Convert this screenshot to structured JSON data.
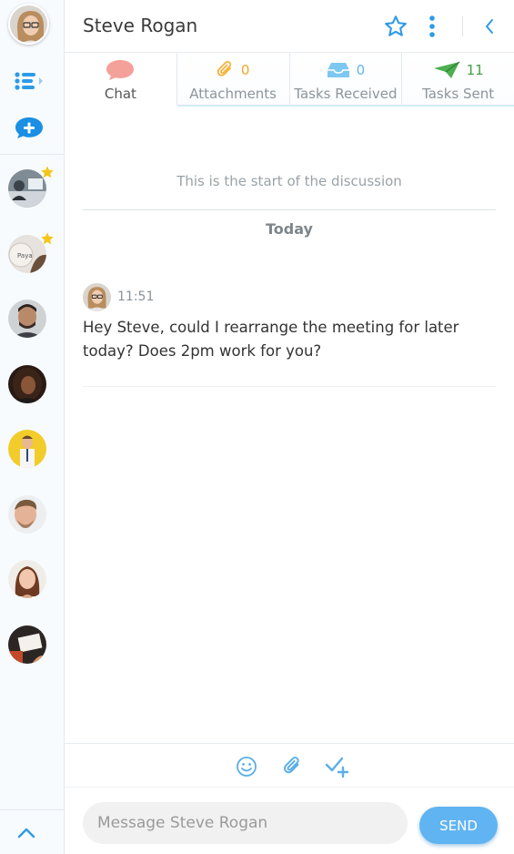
{
  "header": {
    "contact_name": "Steve Rogan"
  },
  "tabs": [
    {
      "label": "Chat",
      "icon": "speech-bubble-icon",
      "color": "#f4a19a"
    },
    {
      "label": "Attachments",
      "icon": "paperclip-icon",
      "count": "0",
      "color": "#f5b23a"
    },
    {
      "label": "Tasks Received",
      "icon": "inbox-tray-icon",
      "count": "0",
      "color": "#7cc8f2"
    },
    {
      "label": "Tasks Sent",
      "icon": "paper-plane-icon",
      "count": "11",
      "color": "#4caf50"
    }
  ],
  "chat": {
    "start_note": "This is the start of the discussion",
    "date_divider": "Today",
    "messages": [
      {
        "time": "11:51",
        "text": "Hey Steve, could I rearrange the meeting for later today? Does 2pm work for you?"
      }
    ]
  },
  "composer": {
    "placeholder": "Message Steve Rogan",
    "send_label": "SEND"
  },
  "sidebar": {
    "contacts": [
      {
        "favorite": true,
        "avatar": "avatar-1"
      },
      {
        "favorite": true,
        "avatar": "avatar-2"
      },
      {
        "favorite": false,
        "avatar": "avatar-3"
      },
      {
        "favorite": false,
        "avatar": "avatar-4"
      },
      {
        "favorite": false,
        "avatar": "avatar-5"
      },
      {
        "favorite": false,
        "avatar": "avatar-6"
      },
      {
        "favorite": false,
        "avatar": "avatar-7"
      },
      {
        "favorite": false,
        "avatar": "avatar-8"
      }
    ]
  },
  "colors": {
    "accent": "#2e9be6",
    "send_button": "#61b4f2",
    "star": "#f5c518",
    "icon_blue": "#5aaee8"
  }
}
